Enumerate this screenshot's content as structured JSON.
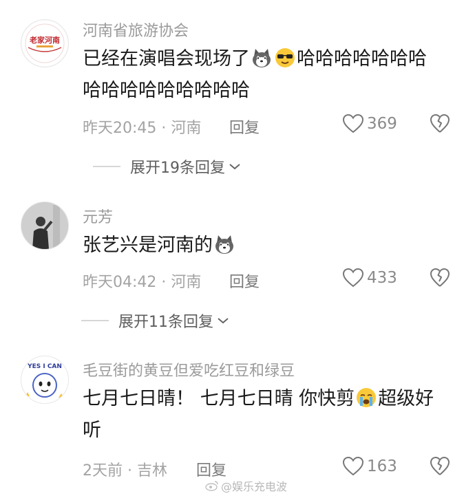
{
  "comments": [
    {
      "username": "河南省旅游协会",
      "avatar_text": "老家河南",
      "text_a": "已经在演唱会现场了",
      "text_b": "哈哈哈哈哈哈哈",
      "text_c": "哈哈哈哈哈哈哈哈哈",
      "time_location": "昨天20:45 · 河南",
      "reply_label": "回复",
      "likes": "369",
      "expand_label": "展开19条回复"
    },
    {
      "username": "元芳",
      "text_a": "张艺兴是河南的",
      "time_location": "昨天04:42 · 河南",
      "reply_label": "回复",
      "likes": "433",
      "expand_label": "展开11条回复"
    },
    {
      "username": "毛豆街的黄豆但爱吃红豆和绿豆",
      "avatar_text": "YES I CAN",
      "text_a": "七月七日晴！ 七月七日晴 你快剪",
      "text_b": "超级好",
      "text_c": "听",
      "time_location": "2天前 · 吉林",
      "reply_label": "回复",
      "likes": "163"
    }
  ],
  "watermark": "@娱乐充电波",
  "icons": [
    "heart-outline-icon",
    "broken-heart-icon",
    "chevron-down-icon",
    "husky-emoji",
    "sunglasses-emoji",
    "crying-emoji",
    "weibo-logo-icon"
  ],
  "colors": {
    "text": "#1a1a1a",
    "meta": "#a3a3a3",
    "username": "#9a9a9a"
  }
}
